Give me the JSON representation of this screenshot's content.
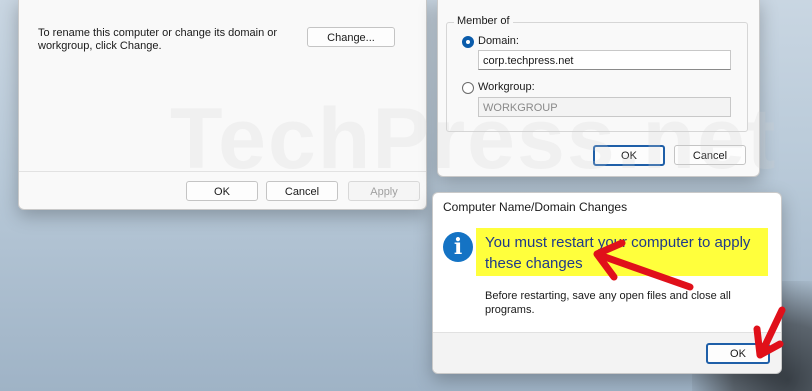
{
  "left_dialog": {
    "description": "To rename this computer or change its domain or workgroup, click Change.",
    "change_button": "Change...",
    "ok_button": "OK",
    "cancel_button": "Cancel",
    "apply_button": "Apply"
  },
  "right_dialog": {
    "group_label": "Member of",
    "domain_label": "Domain:",
    "domain_value": "corp.techpress.net",
    "workgroup_label": "Workgroup:",
    "workgroup_value": "WORKGROUP",
    "ok_button": "OK",
    "cancel_button": "Cancel"
  },
  "message_box": {
    "title": "Computer Name/Domain Changes",
    "icon": "info-icon",
    "main_message": "You must restart your computer to apply these changes",
    "sub_message": "Before restarting, save any open files and close all programs.",
    "ok_button": "OK"
  },
  "watermark": "TechPress.net",
  "colors": {
    "highlight": "#ffff3c",
    "arrow": "#e0101a",
    "info_icon": "#1473c4",
    "accent": "#0b5cab"
  }
}
